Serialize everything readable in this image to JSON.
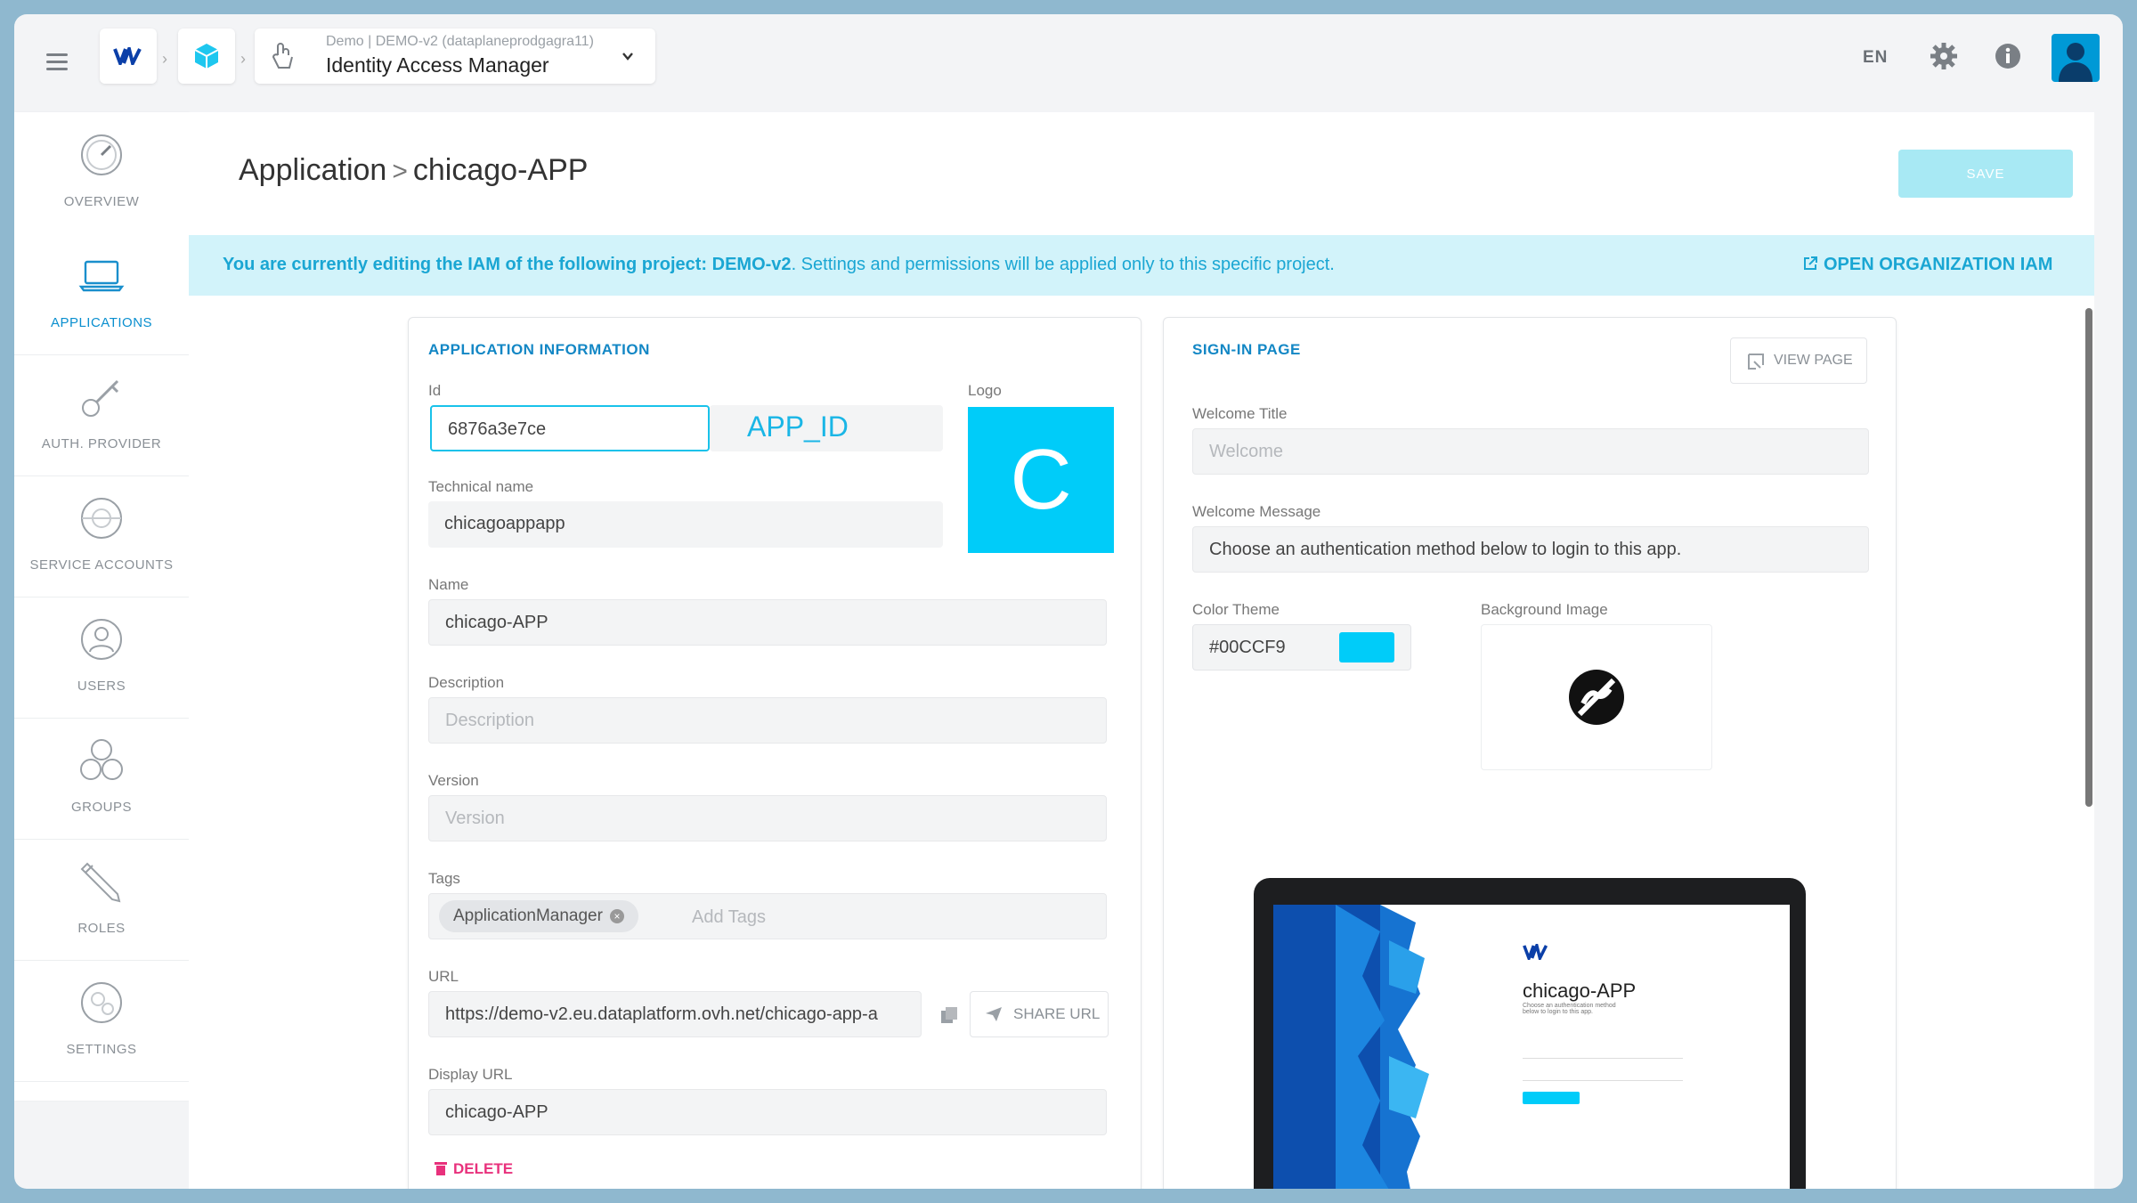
{
  "topbar": {
    "project_sub": "Demo | DEMO-v2 (dataplaneprodgagra11)",
    "app_title": "Identity Access Manager",
    "lang": "EN"
  },
  "sidebar": {
    "items": [
      {
        "label": "OVERVIEW",
        "icon": "gauge-icon"
      },
      {
        "label": "APPLICATIONS",
        "icon": "laptop-icon"
      },
      {
        "label": "AUTH. PROVIDER",
        "icon": "key-icon"
      },
      {
        "label": "SERVICE ACCOUNTS",
        "icon": "service-icon"
      },
      {
        "label": "USERS",
        "icon": "user-icon"
      },
      {
        "label": "GROUPS",
        "icon": "group-icon"
      },
      {
        "label": "ROLES",
        "icon": "pencil-icon"
      },
      {
        "label": "SETTINGS",
        "icon": "settings-icon"
      }
    ]
  },
  "header": {
    "breadcrumb_root": "Application",
    "breadcrumb_sep": ">",
    "breadcrumb_current": "chicago-APP",
    "save_label": "SAVE"
  },
  "banner": {
    "text_prefix": "You are currently editing the IAM of the following project: DEMO-v2",
    "text_suffix": ". Settings and permissions will be applied only to this specific project.",
    "link_label": "OPEN ORGANIZATION IAM"
  },
  "app_info": {
    "heading": "APPLICATION INFORMATION",
    "id_label": "Id",
    "id_value": "6876a3e7ce",
    "id_annotation": "APP_ID",
    "logo_label": "Logo",
    "logo_letter": "C",
    "logo_color": "#00CCF9",
    "technical_name_label": "Technical name",
    "technical_name_value": "chicagoappapp",
    "name_label": "Name",
    "name_value": "chicago-APP",
    "description_label": "Description",
    "description_placeholder": "Description",
    "version_label": "Version",
    "version_placeholder": "Version",
    "tags_label": "Tags",
    "tags": [
      "ApplicationManager"
    ],
    "tags_placeholder": "Add Tags",
    "url_label": "URL",
    "url_value": "https://demo-v2.eu.dataplatform.ovh.net/chicago-app-a",
    "share_label": "SHARE URL",
    "display_url_label": "Display URL",
    "display_url_value": "chicago-APP",
    "delete_label": "DELETE"
  },
  "signin": {
    "heading": "SIGN-IN PAGE",
    "view_page_label": "VIEW PAGE",
    "welcome_title_label": "Welcome Title",
    "welcome_title_placeholder": "Welcome",
    "welcome_message_label": "Welcome Message",
    "welcome_message_value": "Choose an authentication method below to login to this app.",
    "color_theme_label": "Color Theme",
    "color_theme_value": "#00CCF9",
    "background_image_label": "Background Image",
    "preview": {
      "title": "chicago-APP",
      "message": "Choose an authentication method below to login to this app."
    }
  },
  "colors": {
    "accent": "#1797D3",
    "theme": "#00CCF9",
    "banner_bg": "#D2F3FA",
    "delete": "#E8317C"
  }
}
